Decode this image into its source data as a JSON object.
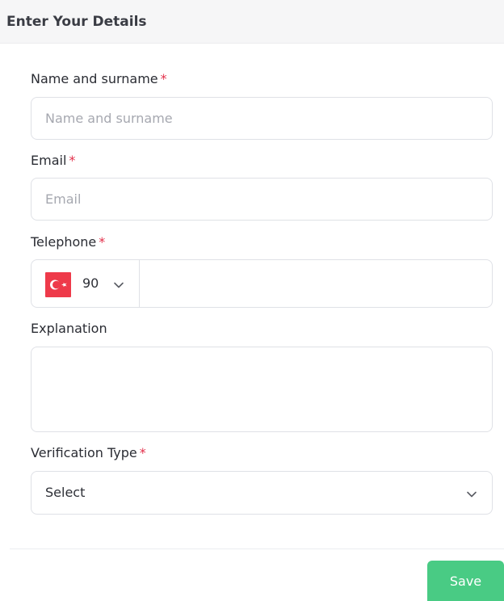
{
  "header": {
    "title": "Enter Your Details"
  },
  "form": {
    "required_marker": "*",
    "name": {
      "label": "Name and surname",
      "placeholder": "Name and surname",
      "value": ""
    },
    "email": {
      "label": "Email",
      "placeholder": "Email",
      "value": ""
    },
    "telephone": {
      "label": "Telephone",
      "country_flag": "turkey-flag",
      "dial_code": "90",
      "value": ""
    },
    "explanation": {
      "label": "Explanation",
      "value": ""
    },
    "verification_type": {
      "label": "Verification Type",
      "selected": "Select"
    }
  },
  "actions": {
    "save_label": "Save"
  },
  "colors": {
    "accent_green": "#49cb84",
    "required_red": "#e3304b",
    "flag_red": "#ee3a4a"
  }
}
